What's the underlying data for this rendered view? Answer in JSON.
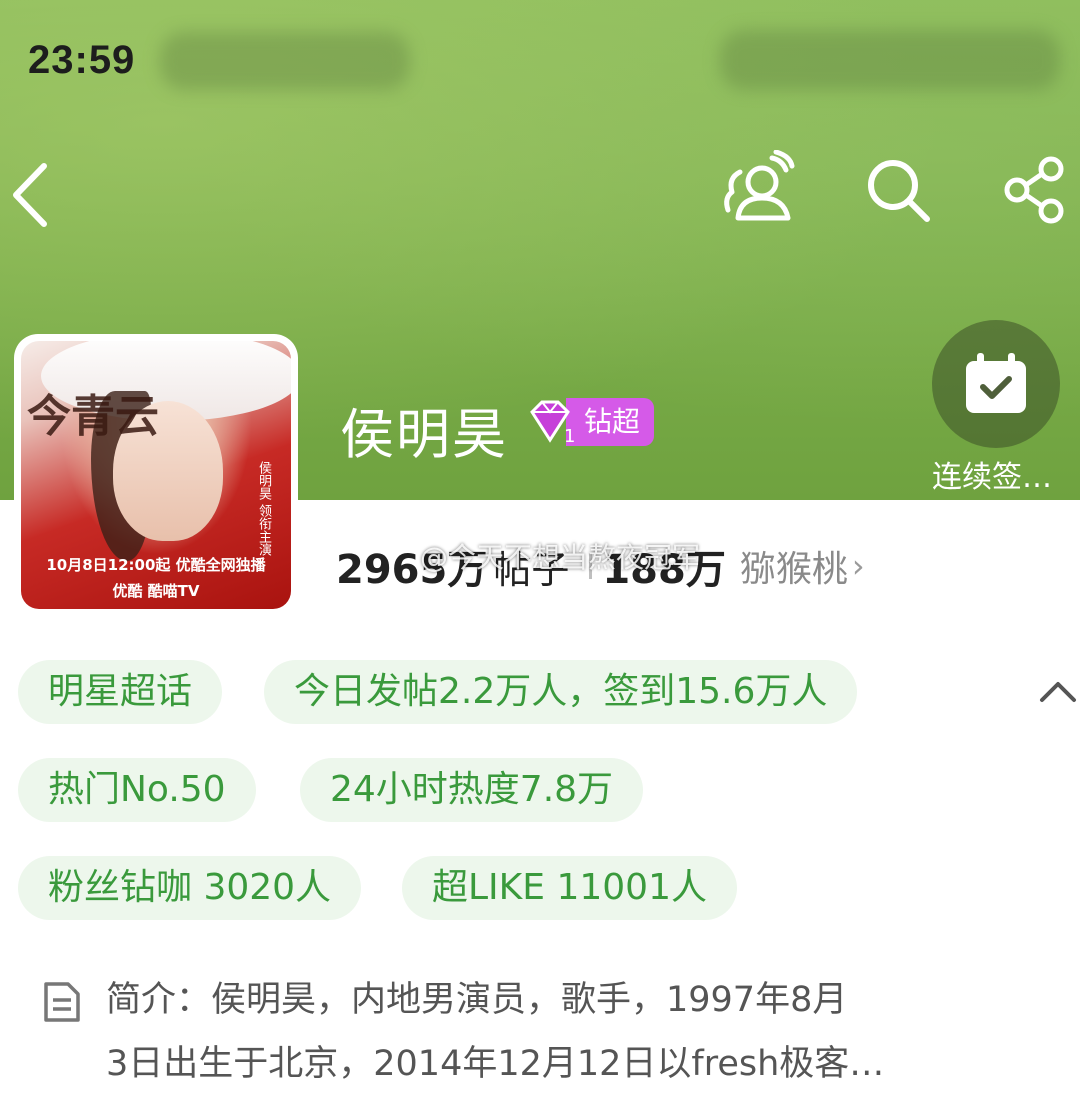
{
  "status_bar": {
    "time": "23:59"
  },
  "header": {
    "icons": [
      "back-icon",
      "friends-icon",
      "search-icon",
      "share-icon"
    ]
  },
  "avatar": {
    "poster_title": "今青云",
    "poster_side": "侯明昊 领衔主演",
    "poster_promo": "10月8日12:00起 优酷全网独播",
    "poster_brand": "优酷  酷喵TV"
  },
  "profile": {
    "name": "侯明昊",
    "badge_label": "钻超",
    "badge_level": "1"
  },
  "checkin": {
    "label": "连续签…"
  },
  "stats": {
    "posts_value": "2965万",
    "posts_label": "帖子",
    "fans_value": "188万",
    "fans_name": "猕猴桃",
    "arrow": "›"
  },
  "watermark": "@今天不想当熬夜冠军",
  "tags": [
    "明星超话",
    "今日发帖2.2万人，签到15.6万人",
    "热门No.50",
    "24小时热度7.8万",
    "粉丝钻咖 3020人",
    "超LIKE 11001人"
  ],
  "intro": {
    "line1": "简介：侯明昊，内地男演员，歌手，1997年8月",
    "line2": "3日出生于北京，2014年12月12日以fresh极客…"
  },
  "colors": {
    "accent_green": "#3a9a3c",
    "tag_bg": "#edf7ec",
    "badge_purple": "#d55ae8"
  }
}
